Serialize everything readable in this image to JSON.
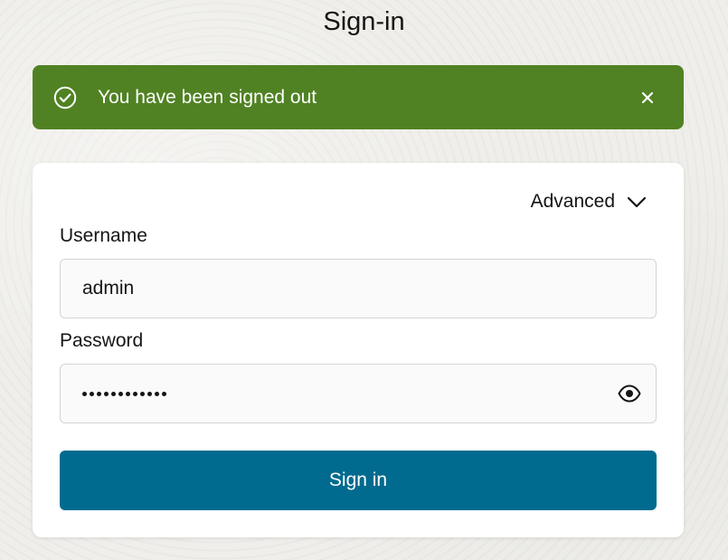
{
  "page": {
    "title": "Sign-in"
  },
  "alert": {
    "message": "You have been signed out",
    "icon": "check-circle-icon",
    "close_icon": "close-icon",
    "color": "#508223"
  },
  "form": {
    "advanced_label": "Advanced",
    "advanced_icon": "chevron-down-icon",
    "username_label": "Username",
    "username_value": "admin",
    "password_label": "Password",
    "password_mask": "••••••••••••",
    "password_length": 12,
    "show_password_icon": "eye-icon",
    "submit_label": "Sign in",
    "submit_color": "#006b8f"
  }
}
